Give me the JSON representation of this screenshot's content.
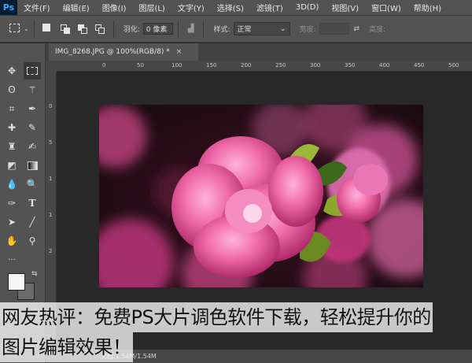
{
  "app": {
    "logo": "Ps"
  },
  "menu": [
    "文件(F)",
    "编辑(E)",
    "图像(I)",
    "图层(L)",
    "文字(Y)",
    "选择(S)",
    "滤镜(T)",
    "3D(D)",
    "视图(V)",
    "窗口(W)",
    "帮助(H)"
  ],
  "options": {
    "feather_label": "羽化:",
    "feather_value": "0 像素",
    "style_label": "样式:",
    "style_value": "正常",
    "width_label": "宽度:",
    "height_label": "高度:"
  },
  "document": {
    "tab_title": "IMG_8268.JPG @ 100%(RGB/8) *",
    "close_glyph": "×",
    "status": "文档:1.54M/1.54M"
  },
  "ruler_top": [
    "0",
    "50",
    "100",
    "150",
    "200",
    "250",
    "300",
    "350",
    "400",
    "450",
    "500"
  ],
  "ruler_left": [
    "0",
    "5",
    "1",
    "1",
    "2"
  ],
  "caption": {
    "line1": "网友热评：免费PS大片调色软件下载，轻松提升你的",
    "line2": "图片编辑效果！"
  },
  "icons": {
    "move": "move-icon",
    "marquee": "marquee-icon",
    "lasso": "lasso-icon",
    "magic": "magic-wand-icon",
    "crop": "crop-icon",
    "eyedropper": "eyedropper-icon",
    "heal": "healing-icon",
    "brush": "brush-icon",
    "stamp": "stamp-icon",
    "history": "history-brush-icon",
    "eraser": "eraser-icon",
    "gradient": "gradient-icon",
    "blur": "blur-icon",
    "dodge": "dodge-icon",
    "pen": "pen-icon",
    "text": "text-icon",
    "path": "path-select-icon",
    "line": "line-icon",
    "hand": "hand-icon",
    "zoom": "zoom-icon"
  },
  "colors": {
    "foreground": "#f5f5f5",
    "background": "#6b6b6b"
  }
}
